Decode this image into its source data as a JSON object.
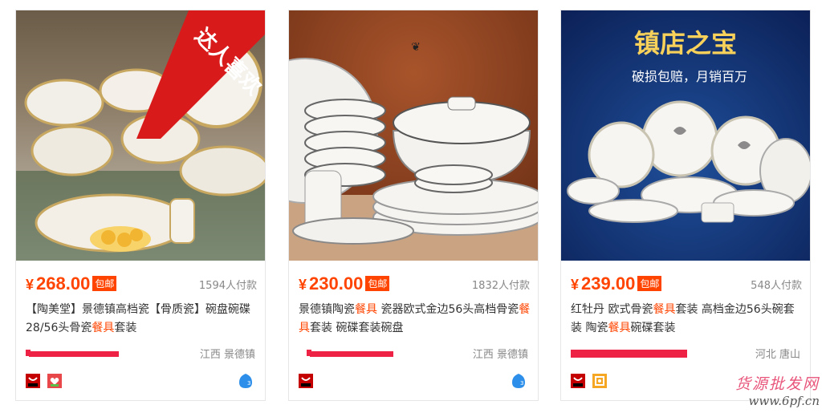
{
  "colors": {
    "accent": "#ff4400",
    "muted": "#888888",
    "text": "#333333"
  },
  "cards": [
    {
      "banner": "达人喜欢",
      "price": {
        "symbol": "¥",
        "amount": "268.00",
        "badge": "包邮"
      },
      "sold": "1594人付款",
      "title": {
        "pre": "【陶美堂】景德镇高档瓷【骨质瓷】碗盘碗碟28/56头骨瓷",
        "hl": "餐具",
        "post": "套装"
      },
      "location": "江西 景德镇",
      "icons": [
        "tmall-icon",
        "gift-icon"
      ]
    },
    {
      "price": {
        "symbol": "¥",
        "amount": "230.00",
        "badge": "包邮"
      },
      "sold": "1832人付款",
      "title": {
        "a": "景德镇陶瓷",
        "hl1": "餐具",
        "b": " 瓷器欧式金边56头高档骨瓷",
        "hl2": "餐具",
        "c": "套装 碗碟套装碗盘"
      },
      "location": "江西 景德镇",
      "icons": [
        "tmall-icon"
      ]
    },
    {
      "promo": {
        "headline": "镇店之宝",
        "sub": "破损包赔，月销百万"
      },
      "price": {
        "symbol": "¥",
        "amount": "239.00",
        "badge": "包邮"
      },
      "sold": "548人付款",
      "title": {
        "a": "红牡丹 欧式骨瓷",
        "hl1": "餐具",
        "b": "套装 高档金边56头碗套装 陶瓷",
        "hl2": "餐具",
        "c": "碗碟套装"
      },
      "location": "河北 唐山",
      "icons": [
        "tmall-icon",
        "gold-seller-icon"
      ]
    }
  ],
  "watermark": {
    "line1": "货源批发网",
    "line2": "www.6pf.cn"
  }
}
